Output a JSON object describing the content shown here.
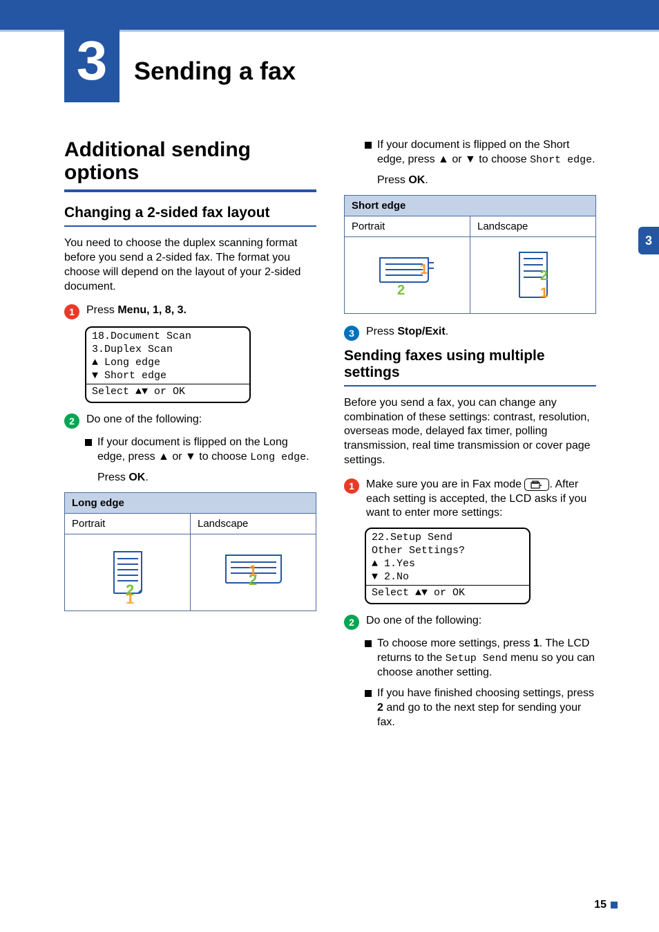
{
  "chapter": {
    "number": "3",
    "title": "Sending a fax"
  },
  "thumb_tab": "3",
  "page_number": "15",
  "left": {
    "section_title": "Additional sending options",
    "subsection_title": "Changing a 2-sided fax layout",
    "intro": "You need to choose the duplex scanning format before you send a 2-sided fax. The format you choose will depend on the layout of your 2-sided document.",
    "step1_prefix": "Press ",
    "step1_menu": "Menu",
    "step1_keys": ", 1, 8, 3.",
    "lcd1": {
      "line1": "18.Document Scan",
      "line2": "  3.Duplex Scan",
      "line3": "▲    Long edge",
      "line4": "▼    Short edge",
      "line5": "Select ▲▼ or OK"
    },
    "step2": "Do one of the following:",
    "bullet_long_a": "If your document is flipped on the Long edge, press ▲ or ▼ to choose ",
    "bullet_long_b": "Long edge",
    "bullet_long_c": ".",
    "press_ok_a": "Press ",
    "press_ok_b": "OK",
    "press_ok_c": ".",
    "table": {
      "header": "Long edge",
      "portrait": "Portrait",
      "landscape": "Landscape"
    }
  },
  "right": {
    "bullet_short_a": "If your document is flipped on the Short edge, press ▲ or ▼ to choose ",
    "bullet_short_b": "Short edge",
    "bullet_short_c": ".",
    "press_ok_a": "Press ",
    "press_ok_b": "OK",
    "press_ok_c": ".",
    "table": {
      "header": "Short edge",
      "portrait": "Portrait",
      "landscape": "Landscape"
    },
    "step3_a": "Press ",
    "step3_b": "Stop/Exit",
    "step3_c": ".",
    "subsection_title": "Sending faxes using multiple settings",
    "intro": "Before you send a fax, you can change any combination of these settings: contrast, resolution, overseas mode, delayed fax timer, polling transmission, real time transmission or cover page settings.",
    "step1_a": "Make sure you are in Fax mode ",
    "step1_b": ". After each setting is accepted, the LCD asks if you want to enter more settings:",
    "lcd2": {
      "line1": "22.Setup Send",
      "line2": "  Other Settings?",
      "line3": "▲    1.Yes",
      "line4": "▼    2.No",
      "line5": "Select ▲▼ or OK"
    },
    "step2": "Do one of the following:",
    "bullet_more_a": "To choose more settings, press ",
    "bullet_more_b": "1",
    "bullet_more_c": ". The LCD returns to the ",
    "bullet_more_d": "Setup Send",
    "bullet_more_e": " menu so you can choose another setting.",
    "bullet_done_a": "If you have finished choosing settings, press ",
    "bullet_done_b": "2",
    "bullet_done_c": " and go to the next step for sending your fax."
  }
}
